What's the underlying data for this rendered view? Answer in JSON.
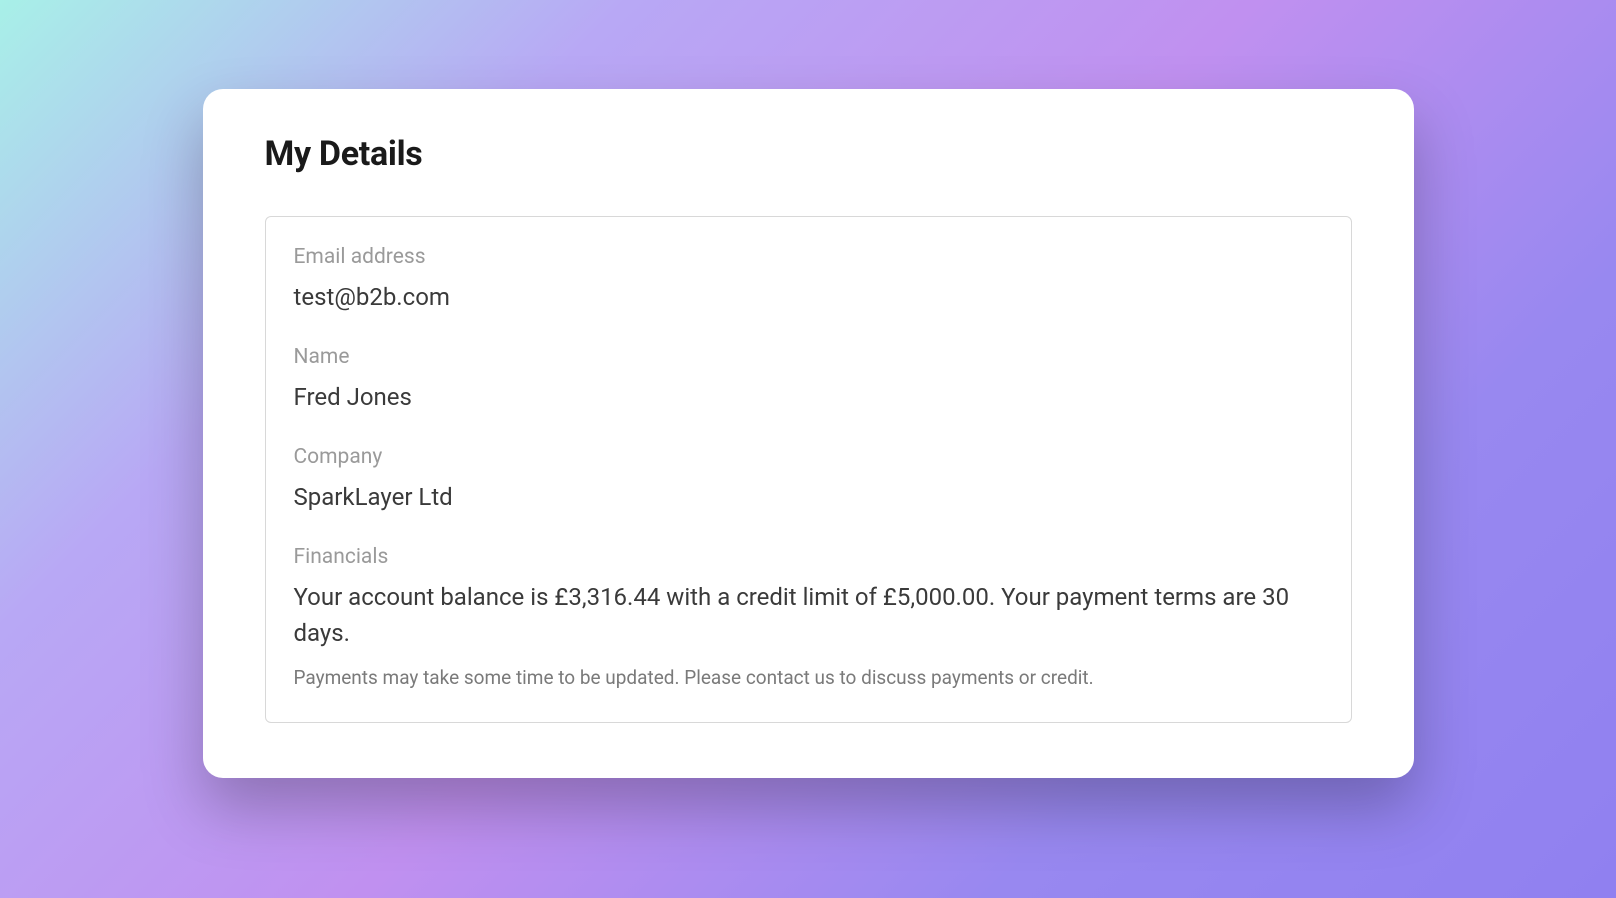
{
  "header": {
    "title": "My Details"
  },
  "details": {
    "email": {
      "label": "Email address",
      "value": "test@b2b.com"
    },
    "name": {
      "label": "Name",
      "value": "Fred Jones"
    },
    "company": {
      "label": "Company",
      "value": "SparkLayer Ltd"
    },
    "financials": {
      "label": "Financials",
      "value": "Your account balance is £3,316.44 with a credit limit of £5,000.00. Your payment terms are 30 days.",
      "note": "Payments may take some time to be updated. Please contact us to discuss payments or credit."
    }
  }
}
